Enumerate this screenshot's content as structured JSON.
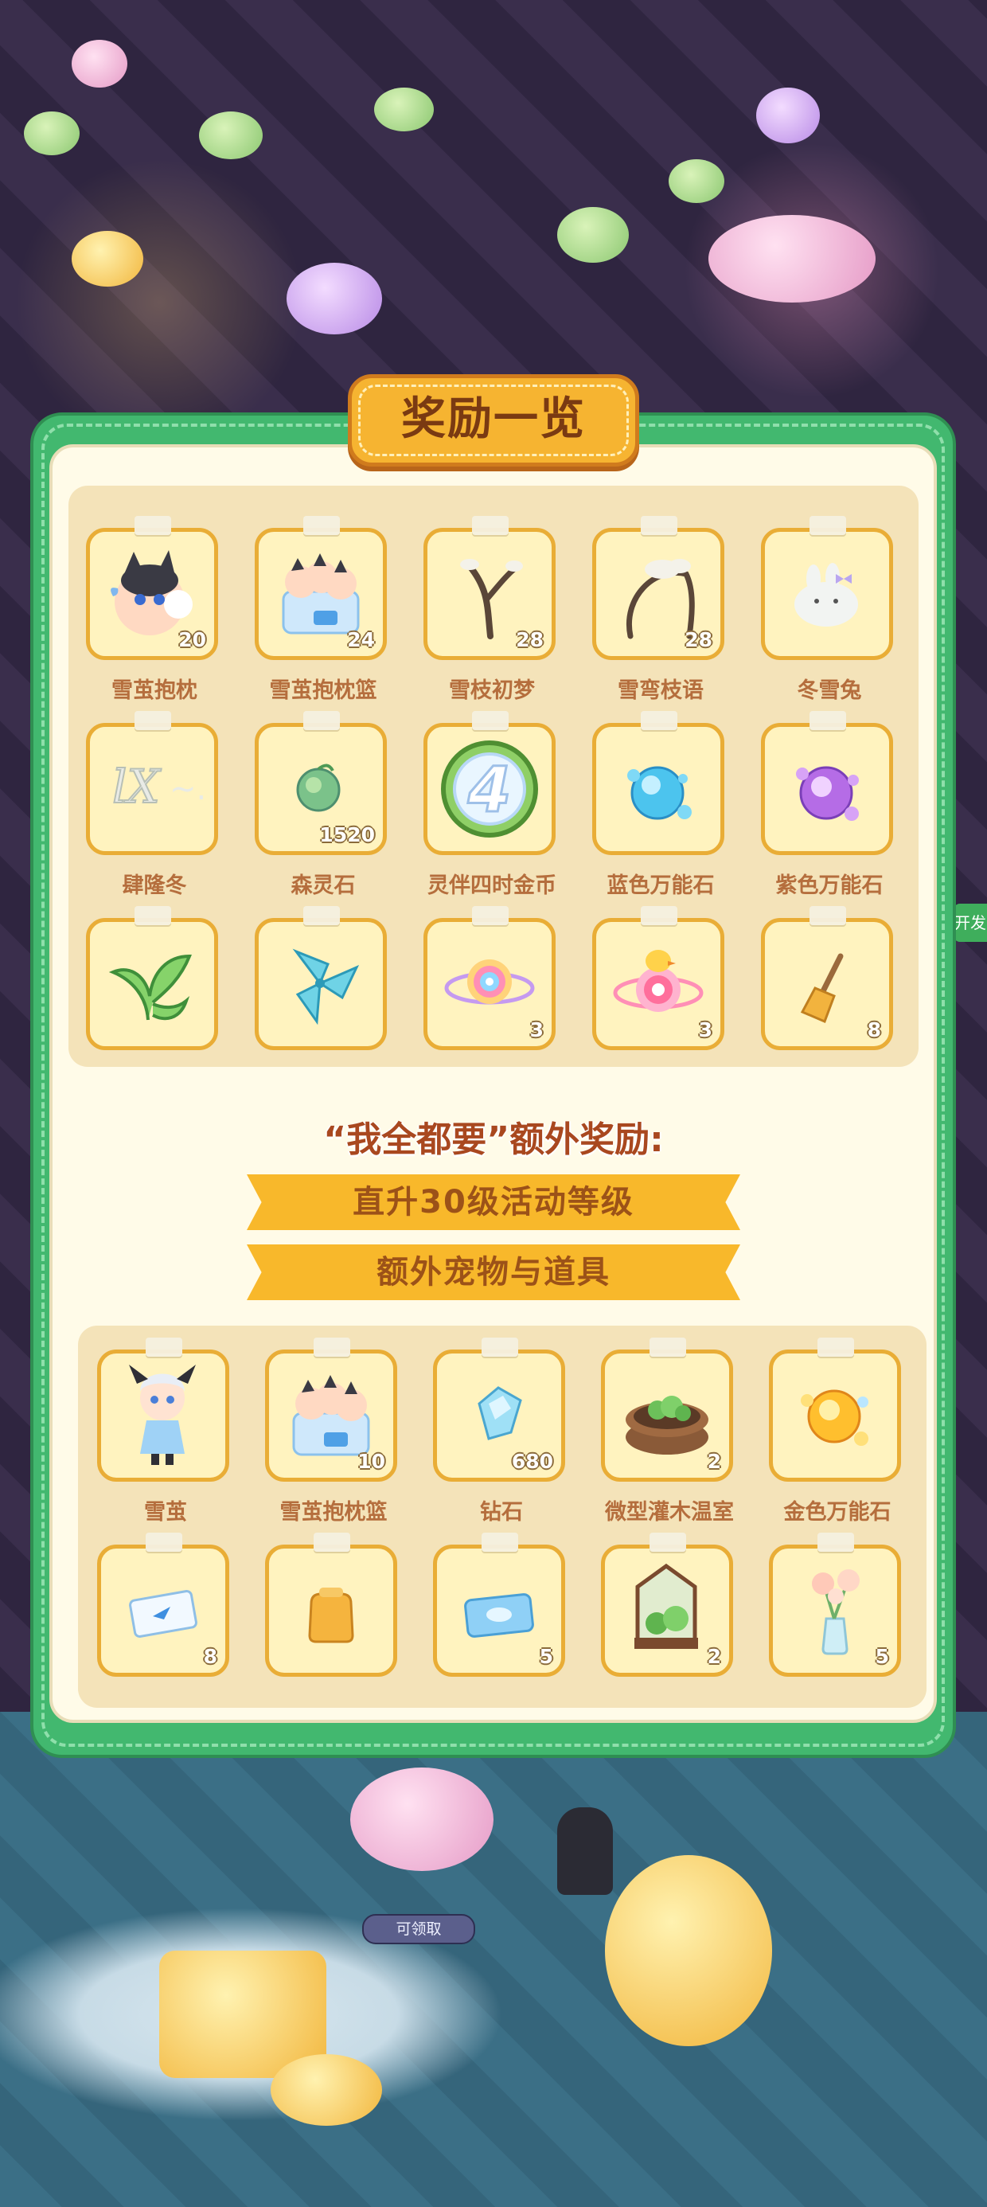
{
  "panel": {
    "title": "奖励一览"
  },
  "rewards": [
    {
      "label": "雪茧抱枕",
      "count": "20",
      "icon": "egg-character-icon"
    },
    {
      "label": "雪茧抱枕篮",
      "count": "24",
      "icon": "pillow-basket-icon"
    },
    {
      "label": "雪枝初梦",
      "count": "28",
      "icon": "snow-branch-icon"
    },
    {
      "label": "雪弯枝语",
      "count": "28",
      "icon": "curved-branch-icon"
    },
    {
      "label": "冬雪兔",
      "count": "",
      "icon": "snow-bunny-icon"
    },
    {
      "label": "肆隆冬",
      "count": "",
      "icon": "winter-nameplate-icon"
    },
    {
      "label": "森灵石",
      "count": "1520",
      "icon": "forest-stone-icon"
    },
    {
      "label": "灵伴四时金币",
      "count": "",
      "icon": "four-coin-icon"
    },
    {
      "label": "蓝色万能石",
      "count": "",
      "icon": "blue-universal-stone-icon"
    },
    {
      "label": "紫色万能石",
      "count": "",
      "icon": "purple-universal-stone-icon"
    },
    {
      "label": "",
      "count": "",
      "icon": "green-sprout-icon"
    },
    {
      "label": "",
      "count": "",
      "icon": "blue-pinwheel-icon"
    },
    {
      "label": "",
      "count": "3",
      "icon": "rainbow-candy-icon"
    },
    {
      "label": "",
      "count": "3",
      "icon": "duck-candy-icon"
    },
    {
      "label": "",
      "count": "8",
      "icon": "broom-icon"
    }
  ],
  "extra": {
    "title": "“我全都要”额外奖励:",
    "ribbon1": "直升30级活动等级",
    "ribbon2": "额外宠物与道具",
    "items": [
      {
        "label": "雪茧",
        "count": "",
        "icon": "snow-girl-icon"
      },
      {
        "label": "雪茧抱枕篮",
        "count": "10",
        "icon": "pillow-basket-icon"
      },
      {
        "label": "钻石",
        "count": "680",
        "icon": "diamond-icon"
      },
      {
        "label": "微型灌木温室",
        "count": "2",
        "icon": "shrub-greenhouse-icon"
      },
      {
        "label": "金色万能石",
        "count": "",
        "icon": "gold-universal-stone-icon"
      },
      {
        "label": "",
        "count": "8",
        "icon": "blue-ticket-icon"
      },
      {
        "label": "",
        "count": "",
        "icon": "yellow-bag-icon"
      },
      {
        "label": "",
        "count": "5",
        "icon": "blue-coupon-icon"
      },
      {
        "label": "",
        "count": "2",
        "icon": "terrarium-icon"
      },
      {
        "label": "",
        "count": "5",
        "icon": "flower-vase-icon"
      }
    ]
  },
  "background": {
    "claim_button": "可领取",
    "side_tag": "开发"
  },
  "colors": {
    "panel_green": "#42b86f",
    "tile_border": "#e9ad36",
    "label_brown": "#b56e3d",
    "ribbon": "#f8b82b"
  }
}
